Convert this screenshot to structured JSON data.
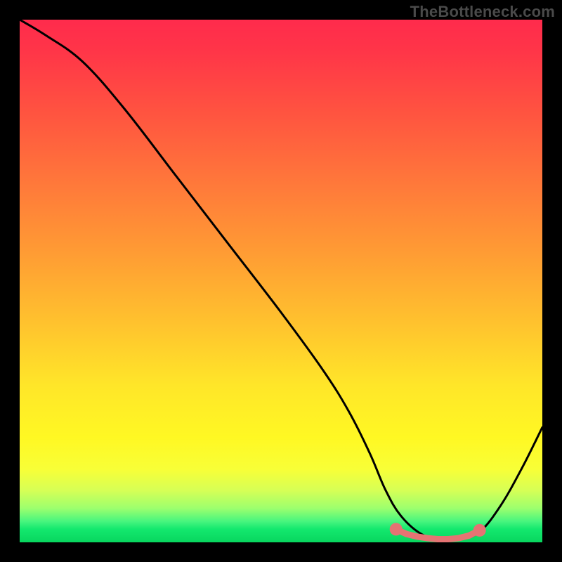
{
  "watermark": "TheBottleneck.com",
  "colors": {
    "page_bg": "#000000",
    "gradient_top": "#ff2b4c",
    "gradient_bottom": "#08d65e",
    "curve": "#000000",
    "marker": "#e57373"
  },
  "chart_data": {
    "type": "line",
    "title": "",
    "xlabel": "",
    "ylabel": "",
    "xlim": [
      0,
      100
    ],
    "ylim": [
      0,
      100
    ],
    "grid": false,
    "legend": false,
    "series": [
      {
        "name": "bottleneck-curve",
        "x": [
          0,
          5,
          12,
          20,
          30,
          40,
          50,
          58,
          63,
          67,
          70,
          73,
          77,
          81,
          84,
          88,
          92,
          96,
          100
        ],
        "y": [
          100,
          97,
          92,
          83,
          70,
          57,
          44,
          33,
          25,
          17,
          10,
          5,
          1.5,
          0.5,
          0.5,
          2,
          7,
          14,
          22
        ]
      }
    ],
    "markers": {
      "name": "valley-highlight",
      "color": "#e57373",
      "points": [
        {
          "x": 72,
          "y": 2.5
        },
        {
          "x": 74,
          "y": 1.6
        },
        {
          "x": 76,
          "y": 1.1
        },
        {
          "x": 78,
          "y": 0.8
        },
        {
          "x": 80,
          "y": 0.6
        },
        {
          "x": 82,
          "y": 0.6
        },
        {
          "x": 84,
          "y": 0.8
        },
        {
          "x": 86,
          "y": 1.3
        },
        {
          "x": 88,
          "y": 2.3
        }
      ]
    }
  }
}
